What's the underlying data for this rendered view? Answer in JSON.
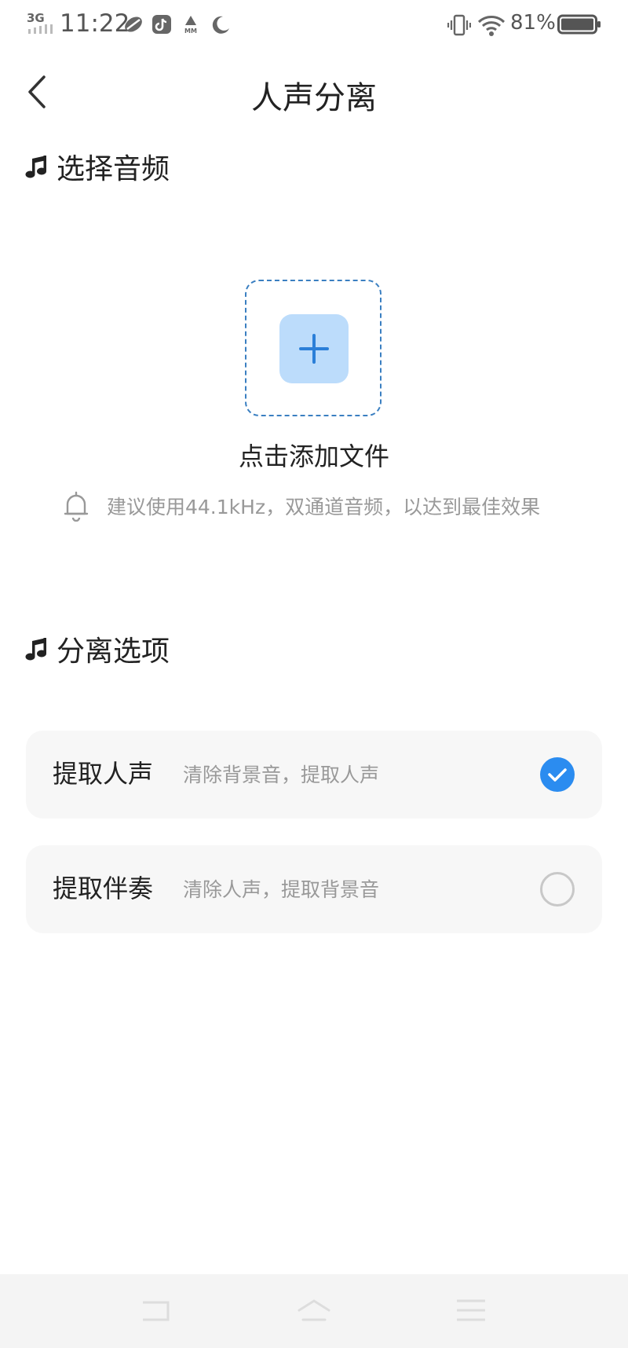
{
  "status_bar": {
    "network": "3G",
    "time": "11:22",
    "battery_percent": "81%",
    "battery_level": 0.81,
    "icons": [
      "leaf-app-icon",
      "tiktok-icon",
      "mm-icon",
      "moon-icon",
      "vibrate-icon",
      "wifi-icon",
      "battery-icon"
    ]
  },
  "header": {
    "title": "人声分离",
    "back_icon": "chevron-left-icon"
  },
  "select_audio": {
    "heading": "选择音频",
    "heading_icon": "music-note-icon",
    "add_icon": "plus-icon",
    "add_label": "点击添加文件",
    "hint_icon": "bell-icon",
    "hint": "建议使用44.1kHz，双通道音频，以达到最佳效果"
  },
  "separation_options": {
    "heading": "分离选项",
    "heading_icon": "music-note-icon",
    "options": [
      {
        "name": "提取人声",
        "desc": "清除背景音，提取人声",
        "selected": true
      },
      {
        "name": "提取伴奏",
        "desc": "清除人声，提取背景音",
        "selected": false
      }
    ]
  },
  "nav_bar": {
    "buttons": [
      "recent-apps-icon",
      "home-icon",
      "menu-icon"
    ]
  },
  "colors": {
    "accent": "#2b8cf0",
    "add_tile_bg": "#bcdcfb",
    "dashed_border": "#3a7fc1",
    "option_bg": "#f7f7f7"
  }
}
